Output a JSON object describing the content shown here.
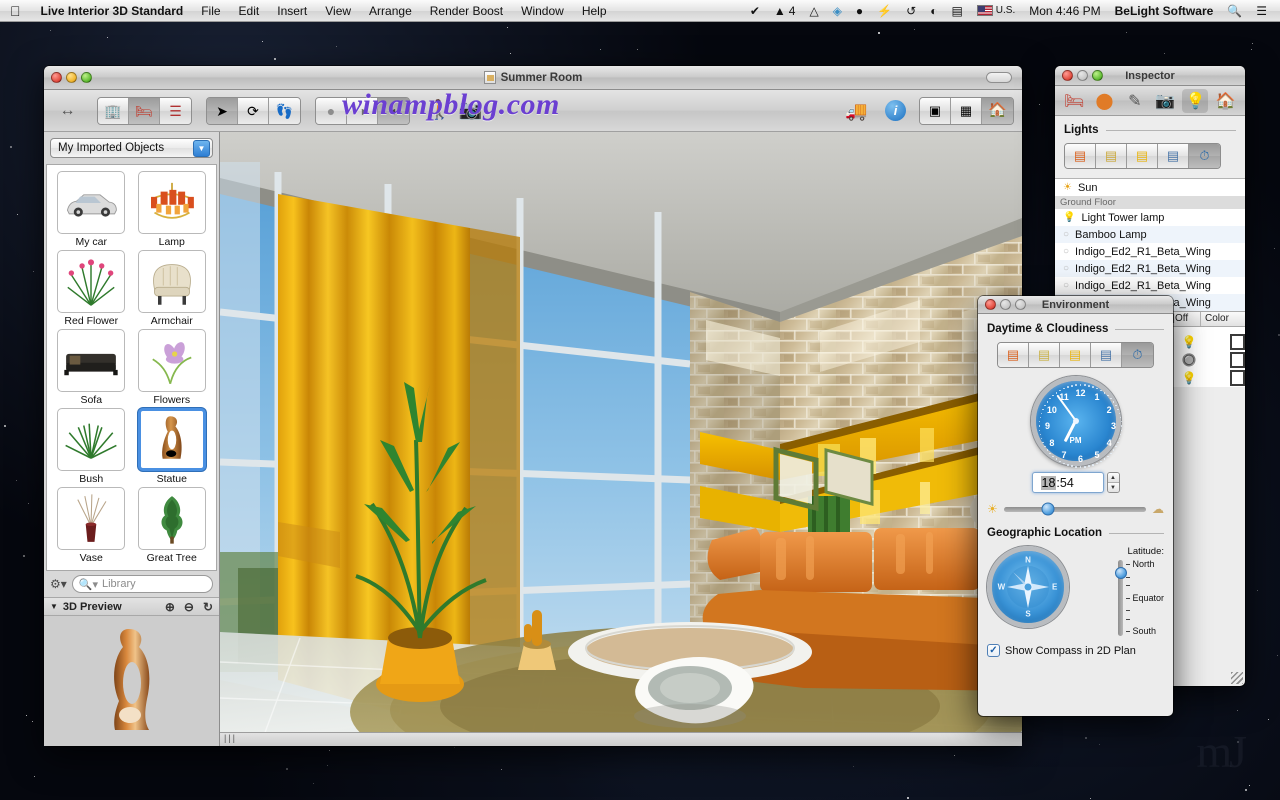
{
  "menubar": {
    "apple_icon": "apple-icon",
    "app_name": "Live Interior 3D Standard",
    "menus": [
      "File",
      "Edit",
      "Insert",
      "View",
      "Arrange",
      "Render Boost",
      "Window",
      "Help"
    ],
    "status_icons": [
      "checkmark-circle-icon",
      "adobe-icon",
      "drive-icon",
      "dropbox-icon",
      "evernote-icon",
      "flash-icon",
      "timemachine-icon",
      "wifi-icon",
      "battery-icon"
    ],
    "adobe_badge": "4",
    "input_source": "U.S.",
    "clock": "Mon 4:46 PM",
    "user": "BeLight Software",
    "spotlight_icon": "search-icon",
    "notification_icon": "list-icon"
  },
  "main_window": {
    "title": "Summer Room",
    "doc_icon": "document-icon",
    "watermark": "winampblog.com",
    "toolbar": {
      "resize_icon": "horizontal-resize-icon",
      "left_group": [
        "building-icon",
        "furniture-icon",
        "list-icon"
      ],
      "tools_group": [
        "arrow-pointer-icon",
        "rotate-icon",
        "walk-measure-icon"
      ],
      "render_group": [
        "sphere-flat-icon",
        "sphere-shaded-icon",
        "sphere-glossy-icon"
      ],
      "walk_icon": "walkthrough-icon",
      "camera_icon": "camera-icon",
      "truck_icon": "moving-truck-icon",
      "info_icon": "info-icon",
      "view_group": [
        "split-view-icon",
        "plan-3d-icon",
        "house-3d-icon"
      ]
    },
    "sidebar": {
      "library_popup": "My Imported Objects",
      "popup_arrow_icon": "chevron-down-icon",
      "objects": [
        {
          "label": "My car",
          "icon": "car-icon"
        },
        {
          "label": "Lamp",
          "icon": "chandelier-icon"
        },
        {
          "label": "Red Flower",
          "icon": "red-flower-icon"
        },
        {
          "label": "Armchair",
          "icon": "armchair-icon"
        },
        {
          "label": "Sofa",
          "icon": "sofa-icon"
        },
        {
          "label": "Flowers",
          "icon": "flowers-icon"
        },
        {
          "label": "Bush",
          "icon": "bush-icon"
        },
        {
          "label": "Statue",
          "icon": "statue-icon",
          "selected": true
        },
        {
          "label": "Vase",
          "icon": "vase-icon"
        },
        {
          "label": "Great Tree",
          "icon": "tree-icon"
        }
      ],
      "gear_icon": "gear-icon",
      "search_icon": "search-icon",
      "search_placeholder": "Library",
      "search_value": "",
      "preview_disclosure_icon": "triangle-down-icon",
      "preview_title": "3D Preview",
      "preview_zoom_in_icon": "zoom-in-icon",
      "preview_zoom_out_icon": "zoom-out-icon",
      "preview_reset_icon": "refresh-icon",
      "preview_object": "statue-3d-preview"
    },
    "viewport": {
      "scene_name": "living-room-3d-render",
      "status_grip": "|||"
    }
  },
  "inspector": {
    "title": "Inspector",
    "toolbar_icons": [
      "object-properties-icon",
      "material-sphere-icon",
      "edit-pencil-icon",
      "camera-icon",
      "light-bulb-icon",
      "house-environment-icon"
    ],
    "active_toolbar_index": 4,
    "lights_section": {
      "title": "Lights",
      "segments": [
        "light-warm-icon",
        "light-neutral-icon",
        "light-yellow-icon",
        "light-cool-icon",
        "light-auto-icon"
      ],
      "active_segment": 4
    },
    "light_list": [
      {
        "label": "Sun",
        "icon": "sun-icon",
        "type": "item"
      },
      {
        "label": "Ground Floor",
        "type": "group"
      },
      {
        "label": "Light Tower lamp",
        "icon": "bulb-on-icon",
        "type": "item"
      },
      {
        "label": "Bamboo Lamp",
        "icon": "bulb-off-icon",
        "type": "item"
      },
      {
        "label": "Indigo_Ed2_R1_Beta_Wing",
        "icon": "bulb-off-icon",
        "type": "item"
      },
      {
        "label": "Indigo_Ed2_R1_Beta_Wing",
        "icon": "bulb-off-icon",
        "type": "item"
      },
      {
        "label": "Indigo_Ed2_R1_Beta_Wing",
        "icon": "bulb-off-icon",
        "type": "item"
      },
      {
        "label": "Indigo_Ed2_R1_Beta_Wing",
        "icon": "bulb-off-icon",
        "type": "item"
      }
    ],
    "table": {
      "columns": [
        "On|Off",
        "Color"
      ],
      "rows": [
        {
          "on_icon": "bulb-on-icon",
          "color": "#ffffff"
        },
        {
          "on_icon": "bulb-off-icon",
          "color": "#ffffff"
        },
        {
          "on_icon": "bulb-on-icon",
          "color": "#ffffff"
        }
      ]
    }
  },
  "environment": {
    "title": "Environment",
    "daytime": {
      "title": "Daytime & Cloudiness",
      "segments": [
        "sunset-icon",
        "daylight-icon",
        "warm-light-icon",
        "cloudy-icon",
        "auto-time-icon"
      ],
      "active_segment": 4
    },
    "clock": {
      "icon": "analog-clock-icon",
      "numbers": [
        "12",
        "1",
        "2",
        "3",
        "4",
        "5",
        "6",
        "7",
        "8",
        "9",
        "10",
        "11"
      ],
      "meridiem": "PM",
      "hour": 6,
      "minute": 54
    },
    "time_field": {
      "hours": "18",
      "separator": ":",
      "minutes": "54",
      "stepper_icon": "stepper-icon"
    },
    "cloud_slider": {
      "left_icon": "sun-small-icon",
      "right_icon": "cloud-small-icon",
      "value_pct": 31
    },
    "geo": {
      "title": "Geographic Location",
      "compass_icon": "compass-icon",
      "compass_labels": [
        "N",
        "E",
        "S",
        "W"
      ],
      "latitude_label": "Latitude:",
      "latitude_ticks": [
        "North",
        "Equator",
        "South"
      ],
      "latitude_pct": 17
    },
    "checkbox": {
      "label": "Show Compass in 2D Plan",
      "checked": true,
      "check_icon": "checkmark-icon"
    }
  },
  "desktop": {
    "corner_watermark": "mJ"
  }
}
